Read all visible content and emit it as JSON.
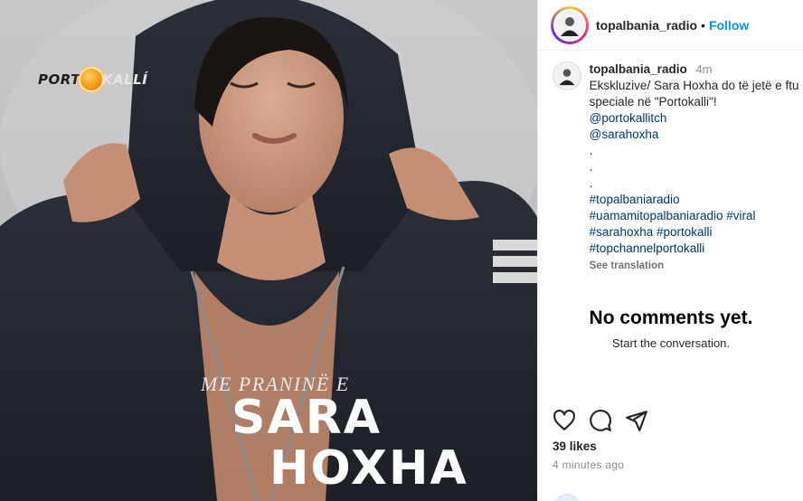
{
  "post": {
    "username": "topalbania_radio",
    "follow_label": "Follow",
    "separator": "•"
  },
  "image": {
    "logo_left": "PORT",
    "logo_right": "KALLÍ",
    "subtitle": "ME PRANINË E",
    "name_line1": "SARA",
    "name_line2": "HOXHA"
  },
  "caption": {
    "username": "topalbania_radio",
    "time": "4m",
    "text_line1": "Ekskluzive/ Sara Hoxha do të jetë e ftu",
    "text_line2": "speciale në \"Portokalli\"!",
    "mentions": [
      "@portokallitch",
      "@sarahoxha"
    ],
    "dots": [
      ".",
      ".",
      "."
    ],
    "hashtag_lines": [
      "#topalbaniaradio",
      "#uamamitopalbaniaradio #viral",
      "#sarahoxha #portokalli",
      "#topchannelportokalli"
    ],
    "see_translation": "See translation"
  },
  "comments": {
    "empty_title": "No comments yet.",
    "empty_subtitle": "Start the conversation."
  },
  "stats": {
    "likes": "39 likes",
    "posted_ago": "4 minutes ago"
  },
  "icons": {
    "like": "heart-icon",
    "comment": "comment-icon",
    "share": "share-icon"
  },
  "colors": {
    "follow_blue": "#0095f6",
    "link_blue": "#00376b",
    "muted": "#8e8e8e"
  }
}
